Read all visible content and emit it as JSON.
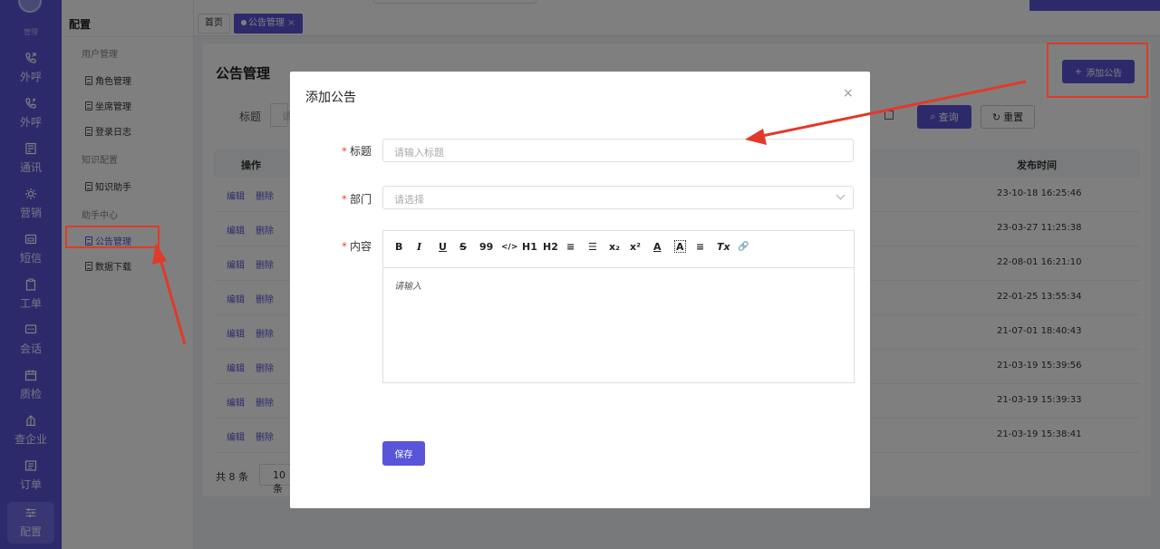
{
  "rail": {
    "logo_sub": "管理",
    "items": [
      {
        "label": "外呼",
        "icon": "phone-outgoing-icon"
      },
      {
        "label": "外呼",
        "icon": "phone-incoming-icon"
      },
      {
        "label": "通讯",
        "icon": "contacts-icon"
      },
      {
        "label": "营销",
        "icon": "marketing-icon"
      },
      {
        "label": "短信",
        "icon": "sms-icon"
      },
      {
        "label": "工单",
        "icon": "clipboard-icon"
      },
      {
        "label": "会话",
        "icon": "chat-icon"
      },
      {
        "label": "质检",
        "icon": "quality-icon"
      },
      {
        "label": "查企业",
        "icon": "enterprise-icon"
      },
      {
        "label": "订单",
        "icon": "order-icon"
      },
      {
        "label": "配置",
        "icon": "settings-sliders-icon"
      }
    ]
  },
  "menu": {
    "title": "配置",
    "groups": [
      {
        "label": "用户管理",
        "items": [
          "角色管理",
          "坐席管理",
          "登录日志"
        ]
      },
      {
        "label": "知识配置",
        "items": [
          "知识助手"
        ]
      },
      {
        "label": "助手中心",
        "items": [
          "公告管理",
          "数据下载"
        ]
      }
    ],
    "selected": "公告管理"
  },
  "tabs": [
    {
      "label": "首页",
      "active": false
    },
    {
      "label": "公告管理",
      "active": true,
      "close": "×"
    }
  ],
  "page": {
    "title": "公告管理",
    "add_button": "添加公告",
    "filter_label": "标题",
    "filter_placeholder": "请",
    "query_button": "查询",
    "reset_button": "重置",
    "columns": {
      "ops": "操作",
      "time": "发布时间"
    },
    "row_ops": {
      "edit": "编辑",
      "delete": "删除"
    },
    "rows": [
      {
        "time": "23-10-18 16:25:46"
      },
      {
        "time": "23-03-27 11:25:38"
      },
      {
        "time": "22-08-01 16:21:10"
      },
      {
        "time": "22-01-25 13:55:34"
      },
      {
        "time": "21-07-01 18:40:43"
      },
      {
        "time": "21-03-19 15:39:56"
      },
      {
        "time": "21-03-19 15:39:33"
      },
      {
        "time": "21-03-19 15:38:41"
      }
    ],
    "total": "共 8 条",
    "page_size": "10条"
  },
  "modal": {
    "title": "添加公告",
    "close": "×",
    "fields": {
      "title_label": "标题",
      "title_placeholder": "请输入标题",
      "dept_label": "部门",
      "dept_placeholder": "请选择",
      "content_label": "内容",
      "content_placeholder": "请输入"
    },
    "required_mark": "*",
    "toolbar": [
      "B",
      "I",
      "U",
      "S",
      "99",
      "</>",
      "H1",
      "H2",
      "≡",
      "☰",
      "x₂",
      "x²",
      "A",
      "A",
      "≡",
      "Tx",
      "🔗"
    ],
    "save_button": "保存"
  },
  "colors": {
    "primary": "#5a55d8",
    "annotation": "#e03a2a",
    "required": "#e84a3c"
  }
}
